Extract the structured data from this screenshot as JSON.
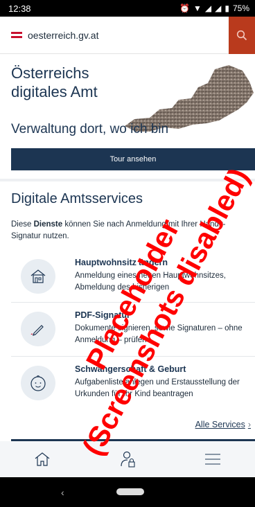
{
  "status_bar": {
    "time": "12:38",
    "battery": "75%"
  },
  "header": {
    "site_name": "oesterreich.gv.at"
  },
  "hero": {
    "title_line1": "Österreichs",
    "title_line2": "digitales Amt",
    "subtitle": "Verwaltung dort, wo ich bin",
    "tour_button": "Tour ansehen"
  },
  "services_section": {
    "title": "Digitale Amtsservices",
    "desc_pre": "Diese ",
    "desc_bold": "Dienste",
    "desc_post": " können Sie nach Anmeldung mit Ihrer Handy-Signatur nutzen.",
    "items": [
      {
        "title": "Hauptwohnsitz ändern",
        "desc": "Anmeldung eines neuen Hauptwohnsitzes, Abmeldung des bisherigen"
      },
      {
        "title": "PDF-Signatur",
        "desc": "Dokumente signieren, sowie Signaturen – ohne Anmeldung – prüfen"
      },
      {
        "title": "Schwangerschaft & Geburt",
        "desc": "Aufgabenliste anlegen und Erstausstellung der Urkunden für Ihr Kind beantragen"
      }
    ],
    "all_services": "Alle Services"
  },
  "watermark": {
    "line1": "Placeholder",
    "line2": "(Screenshots disabled)"
  },
  "colors": {
    "primary": "#1c3552",
    "accent": "#b93a1d",
    "watermark": "#ff0000"
  }
}
